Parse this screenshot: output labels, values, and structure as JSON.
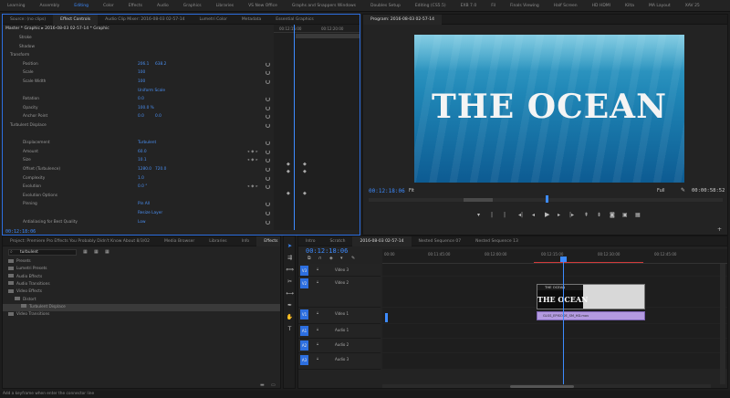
{
  "workspaces": [
    "Learning",
    "Assembly",
    "Editing",
    "Color",
    "Effects",
    "Audio",
    "Graphics",
    "Libraries",
    "VS New Office",
    "Graphs and Snappers Windows",
    "Doubles Setup",
    "Editing (CS5.5)",
    "EXB 7.0",
    "Fil",
    "Finals Viewing",
    "Half Screen",
    "HD HDMI",
    "Kilta",
    "MA Layout",
    "XAV 25"
  ],
  "active_workspace": "Editing",
  "effect_panel": {
    "tabs": [
      "Source: (no clips)",
      "Effect Controls",
      "Audio Clip Mixer: 2016-08-03 02-57-14",
      "Lumetri Color",
      "Metadata",
      "Essential Graphics"
    ],
    "active_tab": "Effect Controls",
    "header": "Master * Graphic  ▸  2016-08-03 02-57-14 * Graphic",
    "rows": [
      {
        "label": "Stroke",
        "v1": "",
        "v2": ""
      },
      {
        "label": "Shadow",
        "v1": "",
        "v2": ""
      },
      {
        "label": "Transform",
        "v1": "",
        "v2": ""
      },
      {
        "label": "Position",
        "v1": "206.1",
        "v2": "638.2"
      },
      {
        "label": "Scale",
        "v1": "100",
        "v2": ""
      },
      {
        "label": "Scale Width",
        "v1": "100",
        "v2": ""
      },
      {
        "label": "",
        "v1": "Uniform Scale",
        "v2": ""
      },
      {
        "label": "Rotation",
        "v1": "0.0",
        "v2": ""
      },
      {
        "label": "Opacity",
        "v1": "100.0 %",
        "v2": ""
      },
      {
        "label": "Anchor Point",
        "v1": "0.0",
        "v2": "0.0"
      },
      {
        "label": "Turbulent Displace",
        "v1": "",
        "v2": ""
      },
      {
        "label": "",
        "v1": "",
        "v2": ""
      },
      {
        "label": "Displacement",
        "v1": "Turbulent",
        "v2": ""
      },
      {
        "label": "Amount",
        "v1": "60.0",
        "v2": ""
      },
      {
        "label": "Size",
        "v1": "10.1",
        "v2": ""
      },
      {
        "label": "Offset (Turbulence)",
        "v1": "1280.0",
        "v2": "720.0"
      },
      {
        "label": "Complexity",
        "v1": "1.0",
        "v2": ""
      },
      {
        "label": "Evolution",
        "v1": "0.0 °",
        "v2": ""
      },
      {
        "label": "Evolution Options",
        "v1": "",
        "v2": ""
      },
      {
        "label": "Pinning",
        "v1": "Pin All",
        "v2": ""
      },
      {
        "label": "",
        "v1": "Resize Layer",
        "v2": ""
      },
      {
        "label": "Antialiasing for Best Quality",
        "v1": "Low",
        "v2": ""
      }
    ],
    "timecode": "00:12:18:06",
    "ruler": [
      "00:12:15:00",
      "00:12:20:00"
    ]
  },
  "program_monitor": {
    "title": "Program: 2016-08-03 02-57-14",
    "video_text": "THE OCEAN",
    "timecode_left": "00:12:18:06",
    "fit": "Fit",
    "quality": "Full",
    "timecode_right": "00:00:58:52"
  },
  "project_panel": {
    "tabs": [
      "Project: Premiere Pro Effects You Probably Didn't Know About 8/3/02",
      "Media Browser",
      "Libraries",
      "Info",
      "Effects",
      "Ma"
    ],
    "active_tab": "Effects",
    "search": "turbulent",
    "items": [
      {
        "label": "Presets",
        "indent": 0
      },
      {
        "label": "Lumetri Presets",
        "indent": 0
      },
      {
        "label": "Audio Effects",
        "indent": 0
      },
      {
        "label": "Audio Transitions",
        "indent": 0
      },
      {
        "label": "Video Effects",
        "indent": 0
      },
      {
        "label": "Distort",
        "indent": 1
      },
      {
        "label": "Turbulent Displace",
        "indent": 2
      },
      {
        "label": "Video Transitions",
        "indent": 0
      }
    ]
  },
  "timeline": {
    "tabs": [
      "Intro",
      "Scratch",
      "2016-08-03 02-57-14",
      "Nested Sequence 07",
      "Nested Sequence 13"
    ],
    "active_tab": "2016-08-03 02-57-14",
    "timecode": "00:12:18:06",
    "ruler": [
      "00:00",
      "00:11:45:00",
      "00:12:00:00",
      "00:12:15:00",
      "00:12:30:00",
      "00:12:45:00"
    ],
    "tracks": [
      {
        "id": "V3",
        "name": "Video 3"
      },
      {
        "id": "V2",
        "name": "Video 2"
      },
      {
        "id": "V1",
        "name": "Video 1"
      },
      {
        "id": "A1",
        "name": "Audio 1"
      },
      {
        "id": "A2",
        "name": "Audio 2"
      },
      {
        "id": "A3",
        "name": "Audio 3"
      }
    ],
    "title_clip_name": "THE OCEAN",
    "title_clip_text": "THE OCEAN",
    "video_clip_name": "GLSS_EPISODE_SM_HD.mov"
  },
  "status": "Add a keyframe when enter the connector line"
}
